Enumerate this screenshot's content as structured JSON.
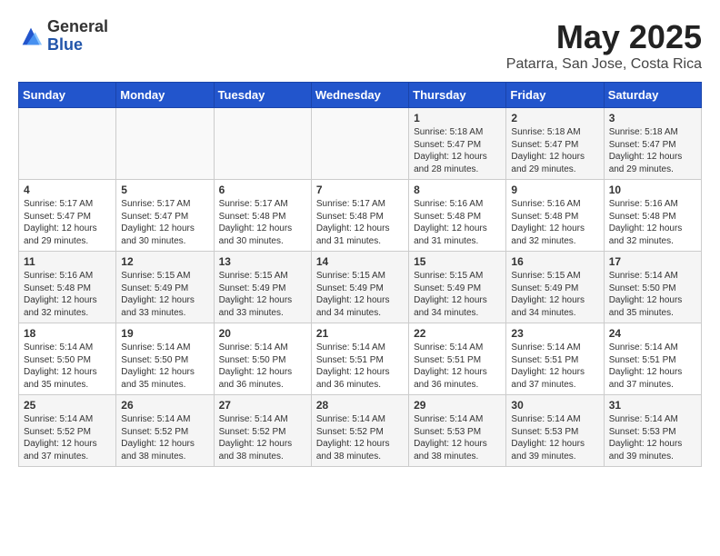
{
  "header": {
    "logo_general": "General",
    "logo_blue": "Blue",
    "month_title": "May 2025",
    "location": "Patarra, San Jose, Costa Rica"
  },
  "calendar": {
    "days_of_week": [
      "Sunday",
      "Monday",
      "Tuesday",
      "Wednesday",
      "Thursday",
      "Friday",
      "Saturday"
    ],
    "weeks": [
      [
        {
          "day": "",
          "info": ""
        },
        {
          "day": "",
          "info": ""
        },
        {
          "day": "",
          "info": ""
        },
        {
          "day": "",
          "info": ""
        },
        {
          "day": "1",
          "info": "Sunrise: 5:18 AM\nSunset: 5:47 PM\nDaylight: 12 hours\nand 28 minutes."
        },
        {
          "day": "2",
          "info": "Sunrise: 5:18 AM\nSunset: 5:47 PM\nDaylight: 12 hours\nand 29 minutes."
        },
        {
          "day": "3",
          "info": "Sunrise: 5:18 AM\nSunset: 5:47 PM\nDaylight: 12 hours\nand 29 minutes."
        }
      ],
      [
        {
          "day": "4",
          "info": "Sunrise: 5:17 AM\nSunset: 5:47 PM\nDaylight: 12 hours\nand 29 minutes."
        },
        {
          "day": "5",
          "info": "Sunrise: 5:17 AM\nSunset: 5:47 PM\nDaylight: 12 hours\nand 30 minutes."
        },
        {
          "day": "6",
          "info": "Sunrise: 5:17 AM\nSunset: 5:48 PM\nDaylight: 12 hours\nand 30 minutes."
        },
        {
          "day": "7",
          "info": "Sunrise: 5:17 AM\nSunset: 5:48 PM\nDaylight: 12 hours\nand 31 minutes."
        },
        {
          "day": "8",
          "info": "Sunrise: 5:16 AM\nSunset: 5:48 PM\nDaylight: 12 hours\nand 31 minutes."
        },
        {
          "day": "9",
          "info": "Sunrise: 5:16 AM\nSunset: 5:48 PM\nDaylight: 12 hours\nand 32 minutes."
        },
        {
          "day": "10",
          "info": "Sunrise: 5:16 AM\nSunset: 5:48 PM\nDaylight: 12 hours\nand 32 minutes."
        }
      ],
      [
        {
          "day": "11",
          "info": "Sunrise: 5:16 AM\nSunset: 5:48 PM\nDaylight: 12 hours\nand 32 minutes."
        },
        {
          "day": "12",
          "info": "Sunrise: 5:15 AM\nSunset: 5:49 PM\nDaylight: 12 hours\nand 33 minutes."
        },
        {
          "day": "13",
          "info": "Sunrise: 5:15 AM\nSunset: 5:49 PM\nDaylight: 12 hours\nand 33 minutes."
        },
        {
          "day": "14",
          "info": "Sunrise: 5:15 AM\nSunset: 5:49 PM\nDaylight: 12 hours\nand 34 minutes."
        },
        {
          "day": "15",
          "info": "Sunrise: 5:15 AM\nSunset: 5:49 PM\nDaylight: 12 hours\nand 34 minutes."
        },
        {
          "day": "16",
          "info": "Sunrise: 5:15 AM\nSunset: 5:49 PM\nDaylight: 12 hours\nand 34 minutes."
        },
        {
          "day": "17",
          "info": "Sunrise: 5:14 AM\nSunset: 5:50 PM\nDaylight: 12 hours\nand 35 minutes."
        }
      ],
      [
        {
          "day": "18",
          "info": "Sunrise: 5:14 AM\nSunset: 5:50 PM\nDaylight: 12 hours\nand 35 minutes."
        },
        {
          "day": "19",
          "info": "Sunrise: 5:14 AM\nSunset: 5:50 PM\nDaylight: 12 hours\nand 35 minutes."
        },
        {
          "day": "20",
          "info": "Sunrise: 5:14 AM\nSunset: 5:50 PM\nDaylight: 12 hours\nand 36 minutes."
        },
        {
          "day": "21",
          "info": "Sunrise: 5:14 AM\nSunset: 5:51 PM\nDaylight: 12 hours\nand 36 minutes."
        },
        {
          "day": "22",
          "info": "Sunrise: 5:14 AM\nSunset: 5:51 PM\nDaylight: 12 hours\nand 36 minutes."
        },
        {
          "day": "23",
          "info": "Sunrise: 5:14 AM\nSunset: 5:51 PM\nDaylight: 12 hours\nand 37 minutes."
        },
        {
          "day": "24",
          "info": "Sunrise: 5:14 AM\nSunset: 5:51 PM\nDaylight: 12 hours\nand 37 minutes."
        }
      ],
      [
        {
          "day": "25",
          "info": "Sunrise: 5:14 AM\nSunset: 5:52 PM\nDaylight: 12 hours\nand 37 minutes."
        },
        {
          "day": "26",
          "info": "Sunrise: 5:14 AM\nSunset: 5:52 PM\nDaylight: 12 hours\nand 38 minutes."
        },
        {
          "day": "27",
          "info": "Sunrise: 5:14 AM\nSunset: 5:52 PM\nDaylight: 12 hours\nand 38 minutes."
        },
        {
          "day": "28",
          "info": "Sunrise: 5:14 AM\nSunset: 5:52 PM\nDaylight: 12 hours\nand 38 minutes."
        },
        {
          "day": "29",
          "info": "Sunrise: 5:14 AM\nSunset: 5:53 PM\nDaylight: 12 hours\nand 38 minutes."
        },
        {
          "day": "30",
          "info": "Sunrise: 5:14 AM\nSunset: 5:53 PM\nDaylight: 12 hours\nand 39 minutes."
        },
        {
          "day": "31",
          "info": "Sunrise: 5:14 AM\nSunset: 5:53 PM\nDaylight: 12 hours\nand 39 minutes."
        }
      ]
    ]
  }
}
